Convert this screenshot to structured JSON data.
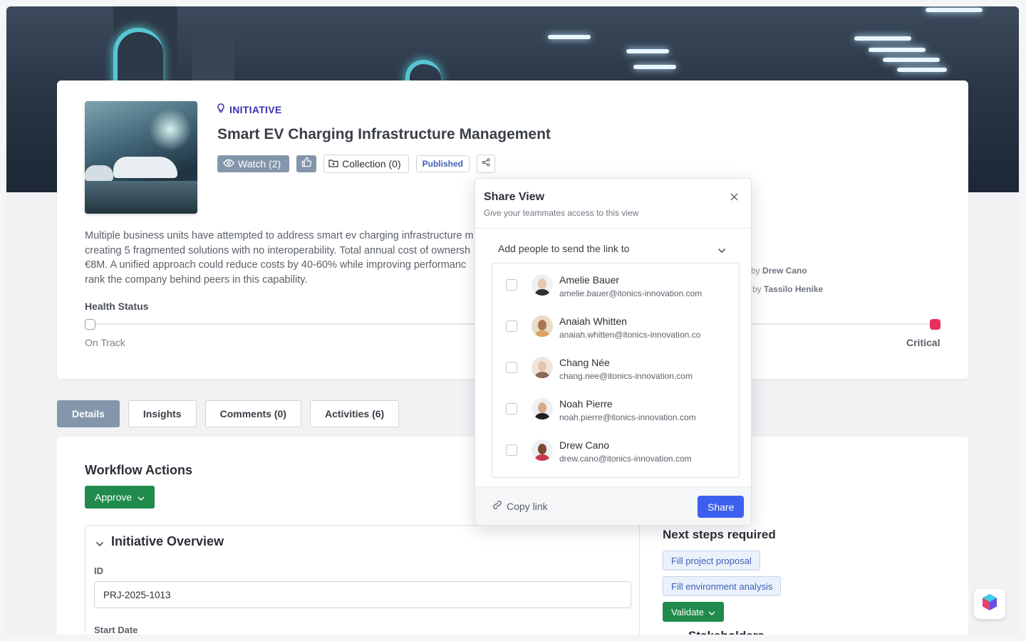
{
  "initiative": {
    "type_label": "INITIATIVE",
    "title": "Smart EV Charging Infrastructure Management",
    "watch_label": "Watch (2)",
    "collection_label": "Collection (0)",
    "status_badge": "Published",
    "description_lines": [
      "Multiple business units have attempted to address smart ev charging infrastructure m",
      "creating 5 fragmented solutions with no interoperability. Total annual cost of ownersh",
      "€8M. A unified approach could reduce costs by 40-60% while improving performanc",
      "rank the company behind peers in this capability."
    ],
    "owners": [
      {
        "prefix": "by",
        "name": "Drew Cano"
      },
      {
        "prefix": "by",
        "name": "Tassilo Henike"
      }
    ],
    "health": {
      "label": "Health Status",
      "start_label": "On Track",
      "end_label": "Critical",
      "critical_color": "#e8305c"
    }
  },
  "tabs": [
    {
      "label": "Details",
      "active": true
    },
    {
      "label": "Insights",
      "active": false
    },
    {
      "label": "Comments (0)",
      "active": false
    },
    {
      "label": "Activities (6)",
      "active": false
    }
  ],
  "details": {
    "workflow_title": "Workflow Actions",
    "approve_label": "Approve",
    "overview_title": "Initiative Overview",
    "id_label": "ID",
    "id_value": "PRJ-2025-1013",
    "start_date_label": "Start Date",
    "next_steps_title": "Next steps required",
    "next_steps": [
      "Fill project proposal",
      "Fill environment analysis"
    ],
    "validate_label": "Validate",
    "stakeholders_title": "Stakeholders"
  },
  "share_popover": {
    "title": "Share View",
    "subtitle": "Give your teammates access to this view",
    "select_placeholder": "Add people to send the link to",
    "people": [
      {
        "name": "Amelie Bauer",
        "email": "amelie.bauer@itonics-innovation.com",
        "skin": "#e9c6ad",
        "shirt": "#2f2f33"
      },
      {
        "name": "Anaiah Whitten",
        "email": "anaiah.whitten@itonics-innovation.co",
        "skin": "#a97552",
        "shirt": "#d9a360"
      },
      {
        "name": "Chang Née",
        "email": "chang.nee@itonics-innovation.com",
        "skin": "#e6c4aa",
        "shirt": "#8c6a55"
      },
      {
        "name": "Noah Pierre",
        "email": "noah.pierre@itonics-innovation.com",
        "skin": "#d7a98a",
        "shirt": "#1e1f24"
      },
      {
        "name": "Drew Cano",
        "email": "drew.cano@itonics-innovation.com",
        "skin": "#7a4b32",
        "shirt": "#c8374b"
      }
    ],
    "copy_link_label": "Copy link",
    "share_label": "Share",
    "accent_color": "#3d5ff0"
  }
}
